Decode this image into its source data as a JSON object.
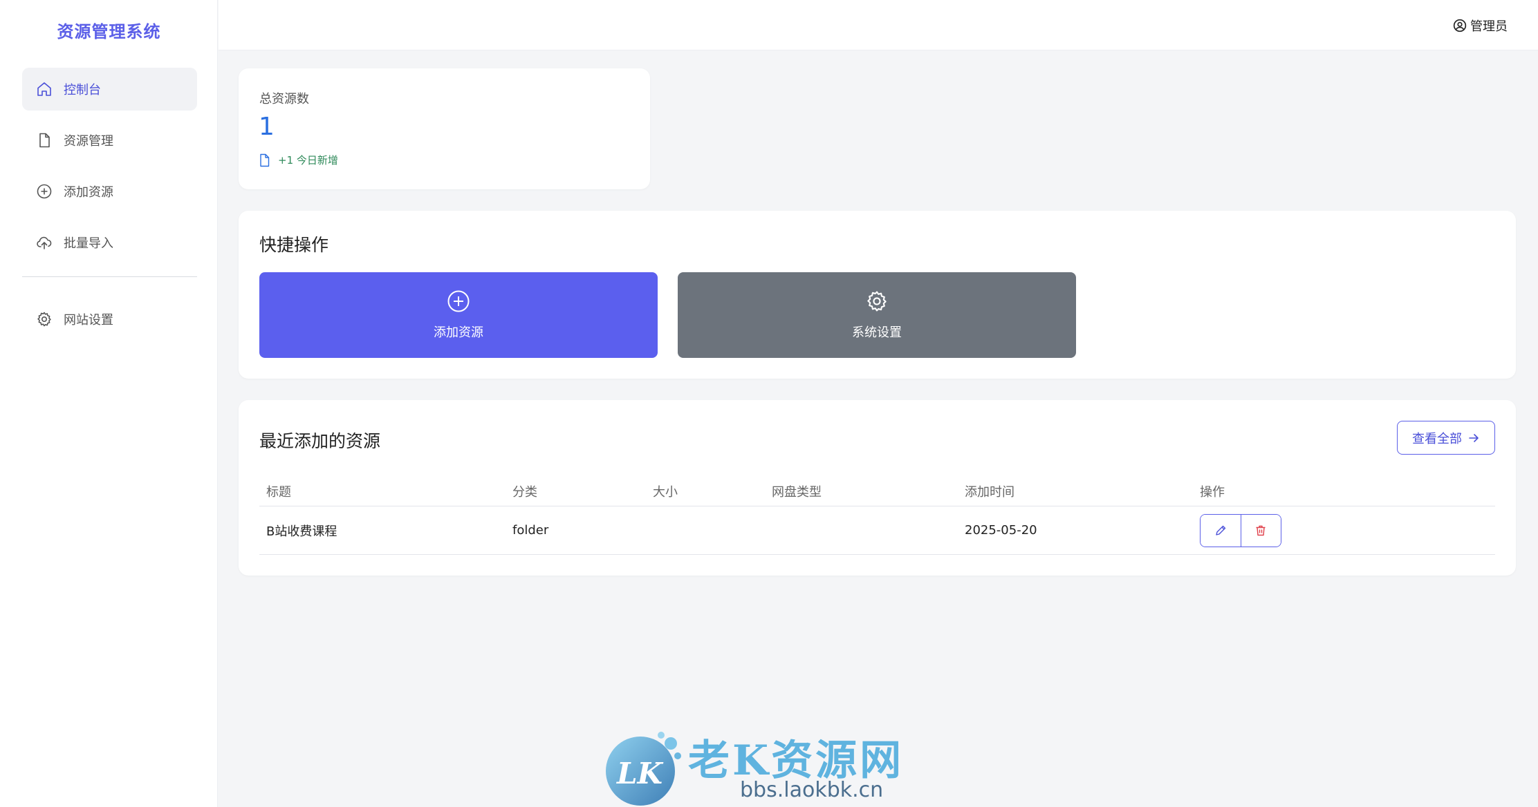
{
  "brand": "资源管理系统",
  "sidebar": {
    "items": [
      {
        "label": "控制台",
        "icon": "home-icon",
        "active": true
      },
      {
        "label": "资源管理",
        "icon": "file-icon"
      },
      {
        "label": "添加资源",
        "icon": "plus-circle-icon"
      },
      {
        "label": "批量导入",
        "icon": "cloud-upload-icon"
      }
    ],
    "settings": {
      "label": "网站设置",
      "icon": "gear-icon"
    }
  },
  "header": {
    "user_label": "管理员",
    "user_icon": "user-circle-icon"
  },
  "stats": {
    "label": "总资源数",
    "value": "1",
    "sub": "+1 今日新增"
  },
  "quick": {
    "title": "快捷操作",
    "add_label": "添加资源",
    "settings_label": "系统设置"
  },
  "recent": {
    "title": "最近添加的资源",
    "view_all": "查看全部",
    "columns": [
      "标题",
      "分类",
      "大小",
      "网盘类型",
      "添加时间",
      "操作"
    ],
    "rows": [
      {
        "title": "B站收费课程",
        "category": "folder",
        "size": "",
        "disk_type": "",
        "date": "2025-05-20"
      }
    ]
  },
  "watermark": {
    "title": "老K资源网",
    "url": "bbs.laokbk.cn",
    "logo_text": "LK"
  },
  "colors": {
    "primary": "#5b5fee",
    "secondary": "#6c737c",
    "accent_blue": "#2b6fe0",
    "success": "#2f8a5a",
    "danger": "#e0414b"
  }
}
